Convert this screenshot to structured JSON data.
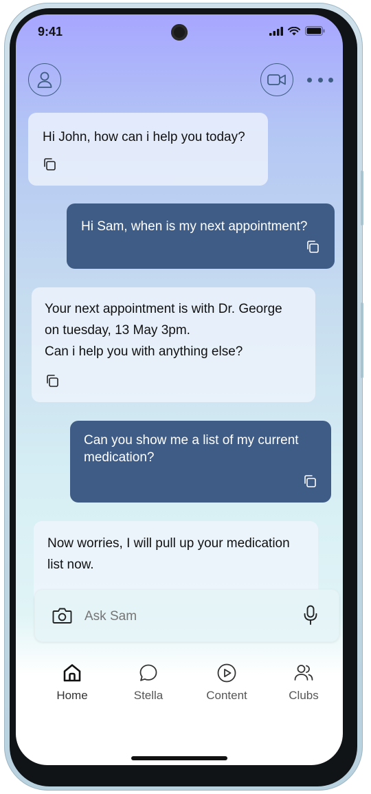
{
  "status_bar": {
    "time": "9:41"
  },
  "header": {
    "profile_icon": "person-icon",
    "video_icon": "video-camera-icon",
    "more_icon": "more-dots-icon"
  },
  "messages": [
    {
      "sender": "bot",
      "text": "Hi John, how can i help you today?"
    },
    {
      "sender": "user",
      "text": "Hi Sam, when is my next appointment?"
    },
    {
      "sender": "bot",
      "lines": [
        "Your next appointment is with Dr. George",
        "on tuesday, 13 May 3pm.",
        "Can i help you with anything else?"
      ]
    },
    {
      "sender": "user",
      "lines": [
        "Can you show me a list of my current",
        "medication?"
      ]
    },
    {
      "sender": "bot",
      "lines": [
        "Now worries, I will pull up your medication",
        "list now."
      ]
    }
  ],
  "input": {
    "placeholder": "Ask Sam",
    "camera_icon": "camera-icon",
    "mic_icon": "microphone-icon"
  },
  "nav": [
    {
      "label": "Home",
      "icon": "home-icon",
      "active": true
    },
    {
      "label": "Stella",
      "icon": "chat-bubble-icon"
    },
    {
      "label": "Content",
      "icon": "play-circle-icon"
    },
    {
      "label": "Clubs",
      "icon": "people-icon"
    }
  ],
  "colors": {
    "user_bubble": "#3f5c86",
    "accent": "#3e5c84",
    "gradient_top": "#a7a6ff"
  }
}
